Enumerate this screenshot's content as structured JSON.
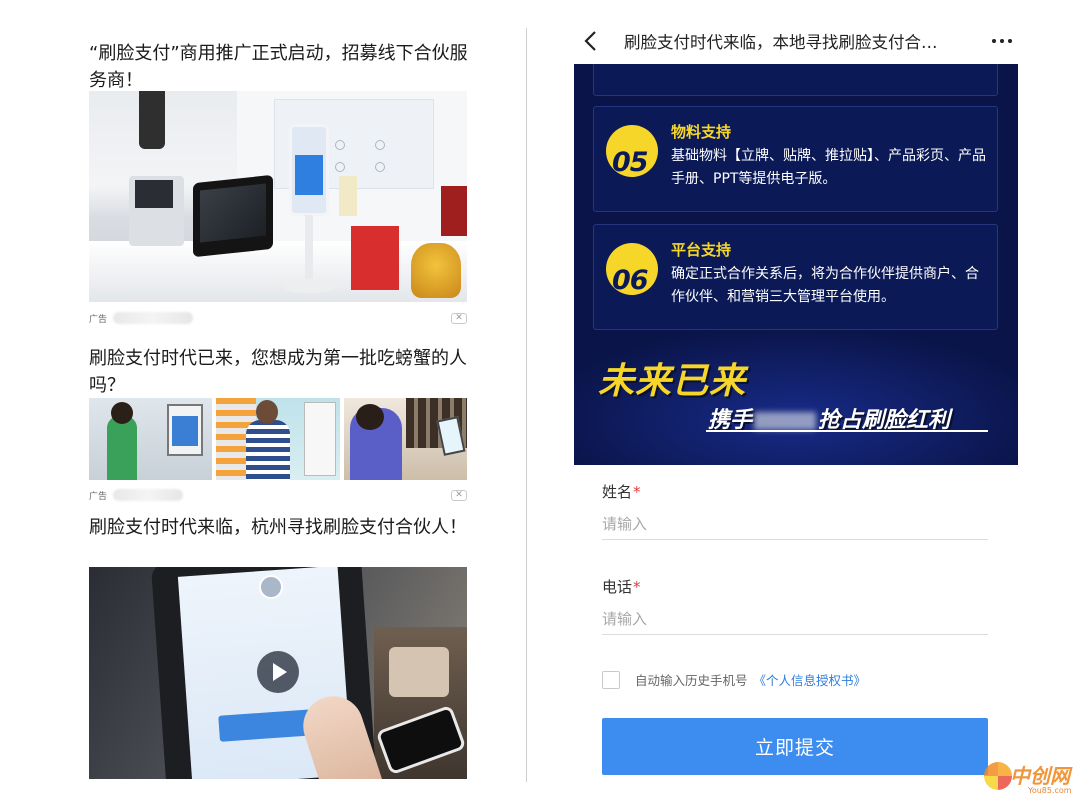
{
  "feed": {
    "post1": {
      "title": "“刷脸支付”商用推广正式启动，招募线下合伙服务商！",
      "ad_label": "广告",
      "close": "✕"
    },
    "post2": {
      "title": "刷脸支付时代已来，您想成为第一批吃螃蟹的人吗？",
      "ad_label": "广告",
      "close": "✕"
    },
    "post3": {
      "title": "刷脸支付时代来临，杭州寻找刷脸支付合伙人！"
    }
  },
  "landing": {
    "nav_title": "刷脸支付时代来临，本地寻找刷脸支付合…",
    "cards": [
      {
        "num": "05",
        "heading": "物料支持",
        "text": "基础物料【立牌、贴牌、推拉贴】、产品彩页、产品手册、PPT等提供电子版。"
      },
      {
        "num": "06",
        "heading": "平台支持",
        "text": "确定正式合作关系后，将为合作伙伴提供商户、合作伙伴、和营销三大管理平台使用。"
      }
    ],
    "slogan_main": "未来已来",
    "slogan_sub_before": "携手",
    "slogan_sub_after": "抢占刷脸红利",
    "form": {
      "name_label": "姓名",
      "name_placeholder": "请输入",
      "phone_label": "电话",
      "phone_placeholder": "请输入",
      "required_mark": "*",
      "checkbox_text": "自动输入历史手机号",
      "checkbox_link": "《个人信息授权书》",
      "submit_label": "立即提交"
    }
  },
  "watermark": {
    "text": "中创网",
    "sub": "You85.com"
  },
  "colors": {
    "banner_bg": "#0a1448",
    "accent_yellow": "#f7d62a",
    "submit_blue": "#3d8cf0",
    "link_blue": "#2f7fe0"
  }
}
